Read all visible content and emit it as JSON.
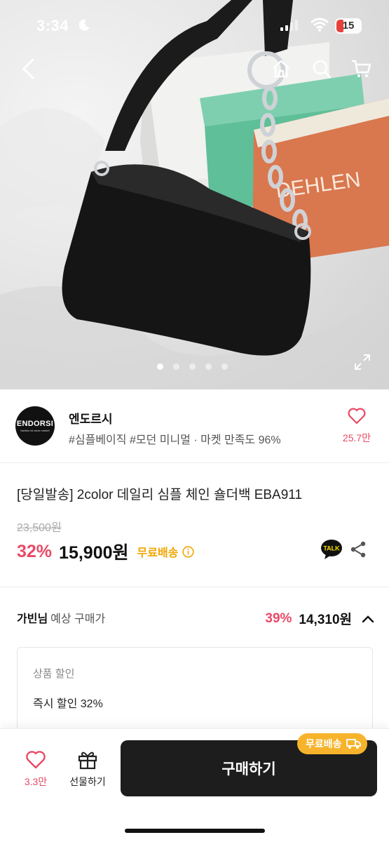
{
  "status_bar": {
    "time": "3:34",
    "battery": "15"
  },
  "seller": {
    "logo_text": "ENDORSI",
    "logo_sub": "fashion tsi wear market",
    "name": "엔도르시",
    "tags": "#심플베이직 #모던 미니멀 · 마켓 만족도 96%",
    "likes": "25.7만"
  },
  "product": {
    "title": "[당일발송] 2color 데일리 심플 체인 숄더백 EBA911",
    "original_price": "23,500원",
    "discount": "32%",
    "price": "15,900원",
    "free_shipping": "무료배송",
    "talk_label": "TALK"
  },
  "member_price": {
    "who": "가빈님",
    "label": "예상 구매가",
    "discount": "39%",
    "price": "14,310원"
  },
  "discount_detail": {
    "header": "상품 할인",
    "value": "즉시 할인 32%"
  },
  "bottom_bar": {
    "likes": "3.3만",
    "gift_label": "선물하기",
    "buy_label": "구매하기",
    "shipping_badge": "무료배송"
  },
  "hero": {
    "slides_total": 5,
    "active_slide": 1
  },
  "colors": {
    "accent_pink": "#e84a66",
    "shipping_yellow": "#f7b32b",
    "buy_bg": "#1d1d1d"
  }
}
